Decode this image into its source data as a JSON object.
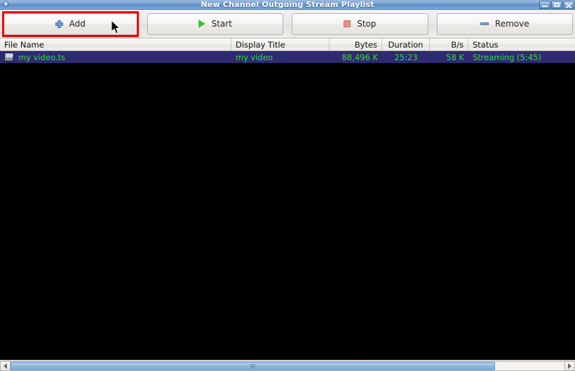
{
  "window": {
    "title": "New Channel Outgoing Stream Playlist",
    "app_icon": "app-bulb-icon",
    "controls": {
      "minimize": "minimize-button",
      "maximize": "maximize-button",
      "close": "close-button"
    }
  },
  "toolbar": {
    "buttons": [
      {
        "label": "Add",
        "icon": "plus-icon",
        "highlighted": true
      },
      {
        "label": "Start",
        "icon": "play-icon",
        "highlighted": false
      },
      {
        "label": "Stop",
        "icon": "stop-icon",
        "highlighted": false
      },
      {
        "label": "Remove",
        "icon": "minus-icon",
        "highlighted": false
      }
    ],
    "highlight_color": "#ee0000"
  },
  "playlist": {
    "columns": [
      {
        "key": "file_name",
        "label": "File Name"
      },
      {
        "key": "display_title",
        "label": "Display Title"
      },
      {
        "key": "bytes",
        "label": "Bytes"
      },
      {
        "key": "duration",
        "label": "Duration"
      },
      {
        "key": "bps",
        "label": "B/s"
      },
      {
        "key": "status",
        "label": "Status"
      }
    ],
    "rows": [
      {
        "icon": "media-file-icon",
        "file_name": "my video.ts",
        "display_title": "my video",
        "bytes": "88,496 K",
        "duration": "25:23",
        "bps": "58 K",
        "status": "Streaming (5:45)"
      }
    ],
    "background_color": "#000000",
    "selected_row_color": "#2e2a72",
    "row_text_color": "#2fe02f"
  },
  "scrollbar": {
    "left_arrow": "scroll-left-arrow",
    "right_arrow": "scroll-right-arrow",
    "thumb": "horizontal-scroll-thumb"
  }
}
